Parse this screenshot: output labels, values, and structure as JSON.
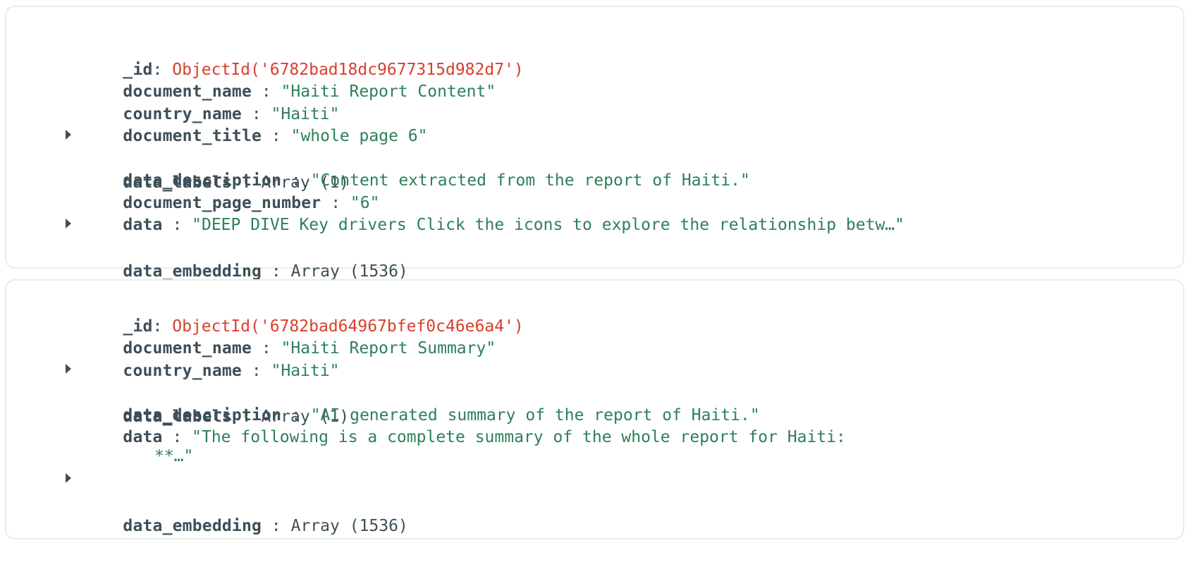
{
  "documents": [
    {
      "fields": {
        "_id": {
          "key": "_id",
          "value": "ObjectId('6782bad18dc9677315d982d7')"
        },
        "document_name": {
          "key": "document_name",
          "value": "\"Haiti Report Content\""
        },
        "country_name": {
          "key": "country_name",
          "value": "\"Haiti\""
        },
        "document_title": {
          "key": "document_title",
          "value": "\"whole page 6\""
        },
        "data_labels": {
          "key": "data_labels",
          "value": "Array (1)"
        },
        "data_description": {
          "key": "data_description",
          "value": "\"Content extracted from the report of Haiti.\""
        },
        "document_page_number": {
          "key": "document_page_number",
          "value": "\"6\""
        },
        "data": {
          "key": "data",
          "value": "\"DEEP DIVE Key drivers Click the icons to explore the relationship betw…\""
        },
        "data_embedding": {
          "key": "data_embedding",
          "value": "Array (1536)"
        }
      }
    },
    {
      "fields": {
        "_id": {
          "key": "_id",
          "value": "ObjectId('6782bad64967bfef0c46e6a4')"
        },
        "document_name": {
          "key": "document_name",
          "value": "\"Haiti Report Summary\""
        },
        "country_name": {
          "key": "country_name",
          "value": "\"Haiti\""
        },
        "data_labels": {
          "key": "data_labels",
          "value": "Array (1)"
        },
        "data_description": {
          "key": "data_description",
          "value": "\"AI generated summary of the report of Haiti.\""
        },
        "data": {
          "key": "data",
          "value": "\"The following is a complete summary of the whole report for Haiti:",
          "continuation": "**…\""
        },
        "data_embedding": {
          "key": "data_embedding",
          "value": "Array (1536)"
        }
      }
    }
  ]
}
